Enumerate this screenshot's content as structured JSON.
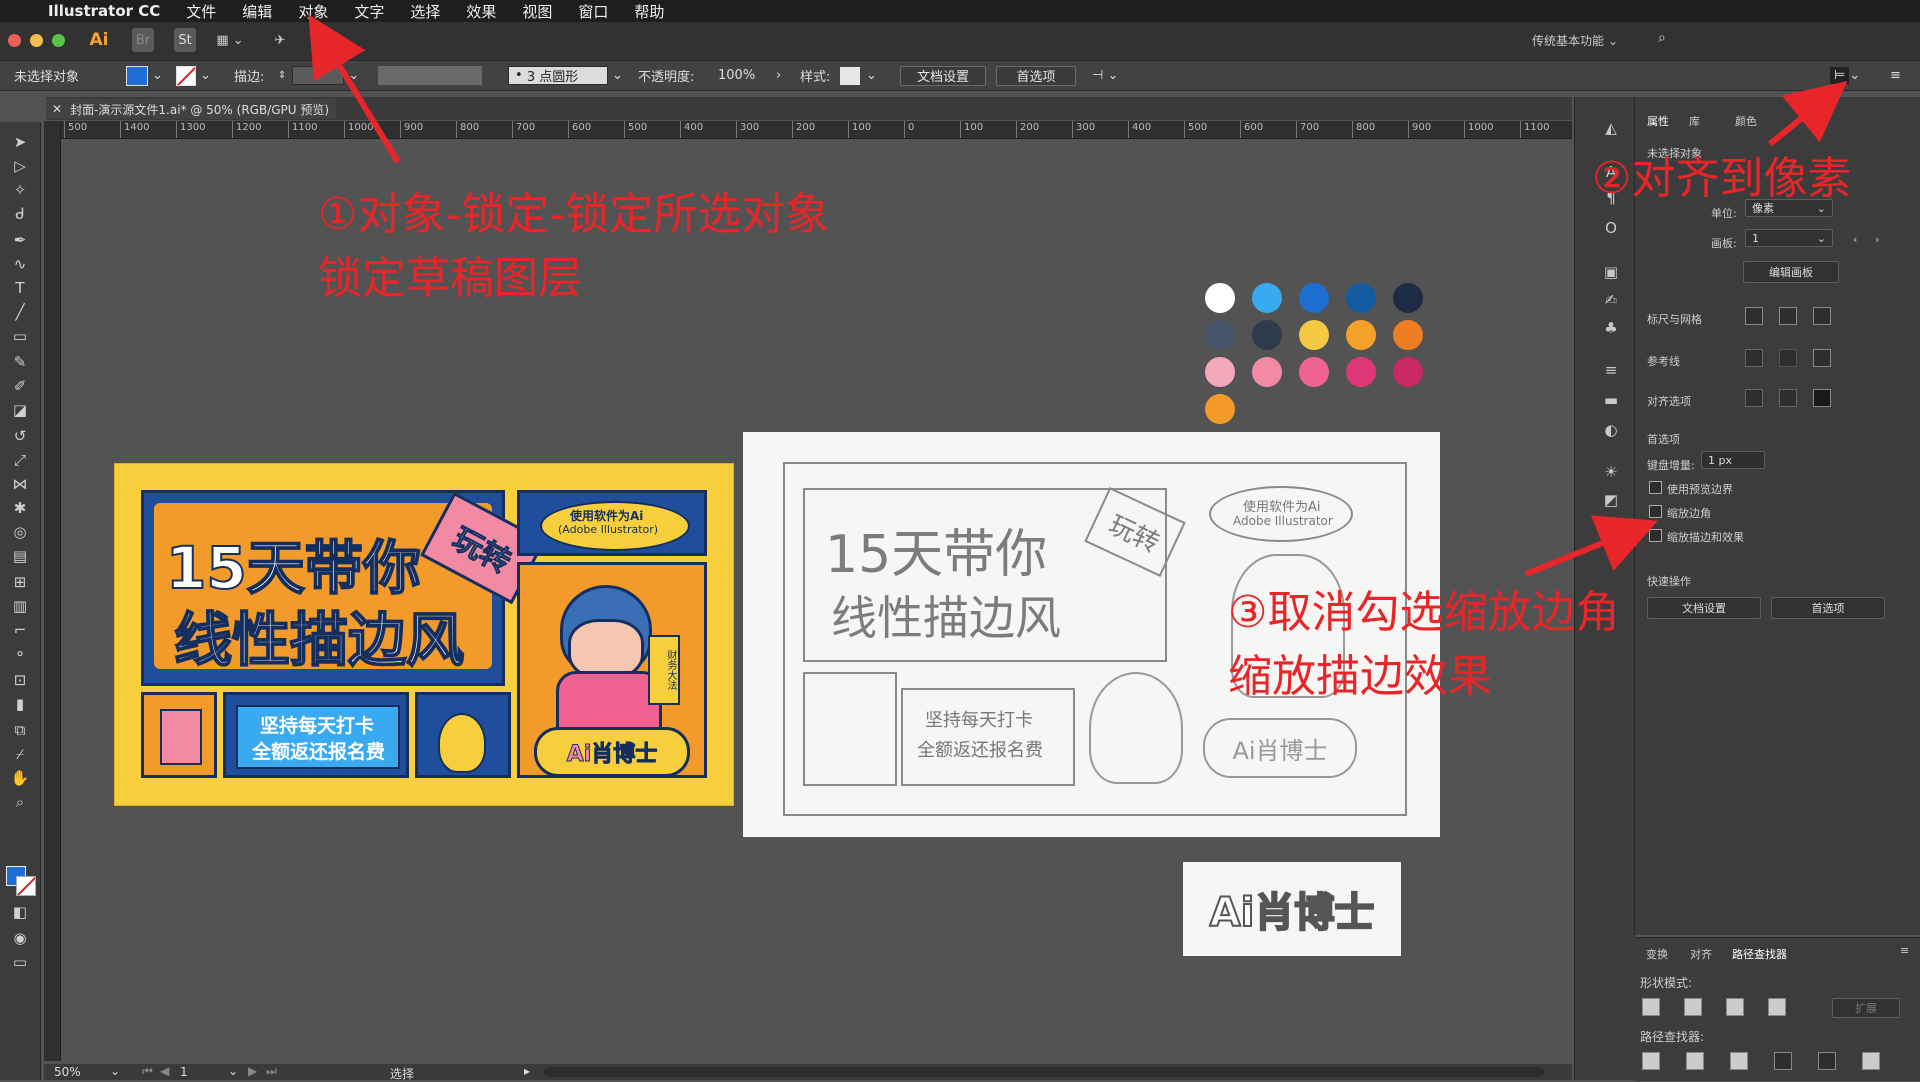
{
  "menubar": {
    "app_name": "Illustrator CC",
    "items": [
      "文件",
      "编辑",
      "对象",
      "文字",
      "选择",
      "效果",
      "视图",
      "窗口",
      "帮助"
    ]
  },
  "appbar": {
    "logo": "Ai",
    "br": "Br",
    "st": "St",
    "workspace": "传统基本功能",
    "search_icon": "search-icon"
  },
  "control": {
    "selection": "未选择对象",
    "stroke_label": "描边:",
    "brush": "3 点圆形",
    "opacity_label": "不透明度:",
    "opacity_value": "100%",
    "style_label": "样式:",
    "doc_settings": "文档设置",
    "preferences": "首选项"
  },
  "doc_tab": {
    "title": "封面-演示源文件1.ai* @ 50% (RGB/GPU 预览)"
  },
  "ruler": {
    "ticks": [
      "500",
      "1400",
      "1300",
      "1200",
      "1100",
      "1000",
      "900",
      "800",
      "700",
      "600",
      "500",
      "400",
      "300",
      "200",
      "100",
      "0",
      "100",
      "200",
      "300",
      "400",
      "500",
      "600",
      "700",
      "800",
      "900",
      "1000",
      "1100"
    ]
  },
  "annotations": {
    "step1_line1": "①对象-锁定-锁定所选对象",
    "step1_line2": "锁定草稿图层",
    "step2": "②对齐到像素",
    "step3_line1": "③取消勾选缩放边角",
    "step3_line2": "缩放描边效果"
  },
  "swatches": [
    "#ffffff",
    "#3aaaf0",
    "#1d6fd1",
    "#145aa0",
    "#1e2b44",
    "#47566a",
    "#2f3b4c",
    "#f5c842",
    "#f3a12a",
    "#ef7d22",
    "#f4a9bb",
    "#f28aa4",
    "#f06292",
    "#de3778",
    "#c92a63",
    "#f39a28"
  ],
  "artboard_color": {
    "cover_bg": "#f7cf3c",
    "cover_blue": "#1f4f9c",
    "cover_orange": "#f29a2a"
  },
  "cover": {
    "title_line1": "15天带你",
    "title_line2": "线性描边风",
    "badge": "玩转",
    "software_line1": "使用软件为Ai",
    "software_line2": "(Adobe Illustrator)",
    "checkin_line1": "坚持每天打卡",
    "checkin_line2": "全额返还报名费",
    "brand": "Ai肖博士",
    "book": "财务大法"
  },
  "sketch": {
    "title_line1": "15天带你",
    "title_line2": "线性描边风",
    "badge": "玩转",
    "software_line1": "使用软件为Ai",
    "software_line2": "Adobe Illustrator",
    "checkin_line1": "坚持每天打卡",
    "checkin_line2": "全额返还报名费",
    "brand": "Ai肖博士"
  },
  "logo_sample": "Ai肖博士",
  "properties": {
    "tabs": [
      "属性",
      "库",
      "颜色"
    ],
    "no_selection": "未选择对象",
    "unit_label": "单位:",
    "unit_value": "像素",
    "artboard_label": "画板:",
    "artboard_value": "1",
    "edit_artboard": "编辑画板",
    "rulers_grid": "标尺与网格",
    "guides": "参考线",
    "snap_options": "对齐选项",
    "preferences_title": "首选项",
    "keyboard_increment_label": "键盘增量:",
    "keyboard_increment_value": "1 px",
    "opt_preview_bounds": "使用预览边界",
    "opt_scale_corners": "缩放边角",
    "opt_scale_strokes": "缩放描边和效果",
    "quick_actions": "快速操作",
    "doc_settings": "文档设置",
    "preferences": "首选项"
  },
  "pathfinder": {
    "tabs": [
      "变换",
      "对齐",
      "路径查找器"
    ],
    "shape_modes": "形状模式:",
    "expand": "扩展",
    "pathfinders": "路径查找器:"
  },
  "status": {
    "zoom": "50%",
    "page": "1",
    "mode": "选择"
  }
}
